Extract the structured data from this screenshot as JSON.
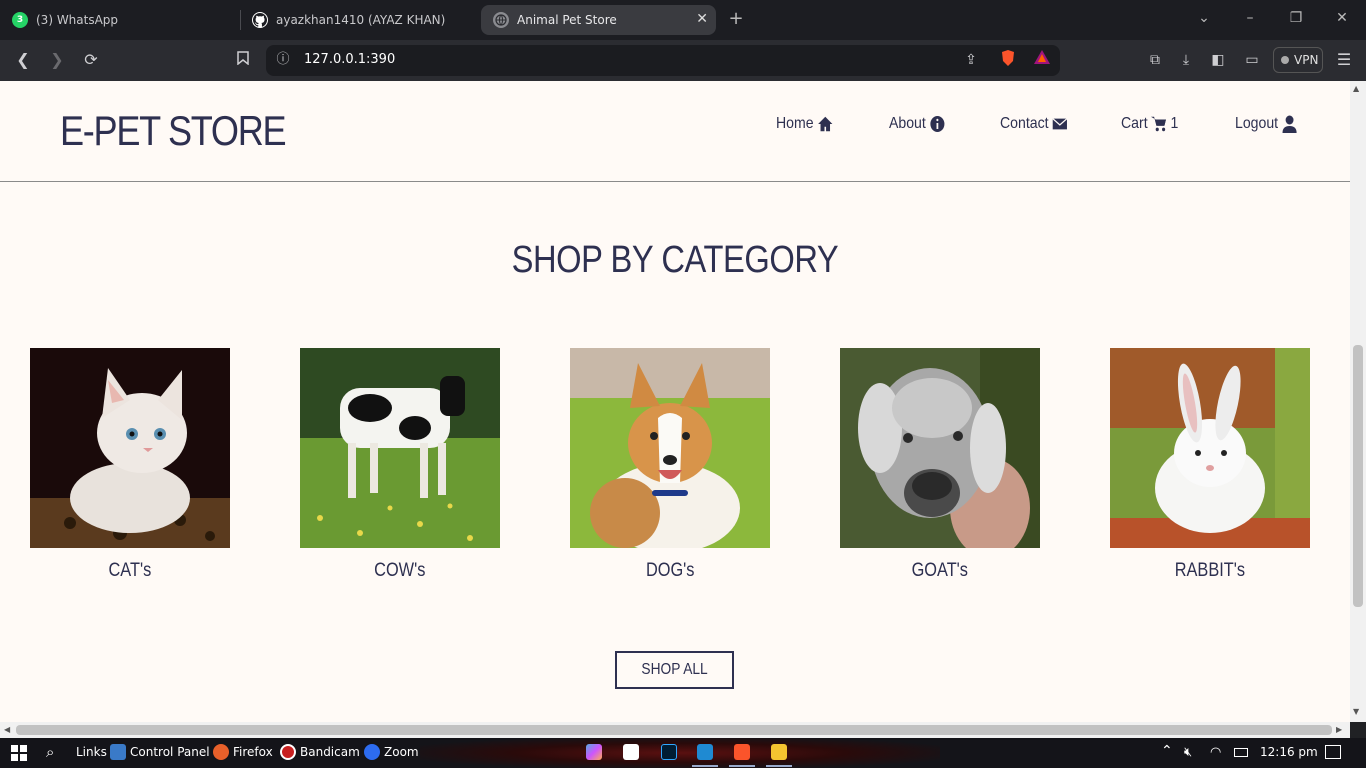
{
  "browser": {
    "tabs": [
      {
        "label": "(3) WhatsApp",
        "icon": "whatsapp-icon",
        "badge": "3"
      },
      {
        "label": "ayazkhan1410 (AYAZ KHAN)",
        "icon": "github-icon"
      },
      {
        "label": "Animal Pet Store",
        "icon": "globe-icon",
        "active": true
      }
    ],
    "new_tab_symbol": "+",
    "url": "127.0.0.1:390",
    "vpn_label": "VPN"
  },
  "site": {
    "brand": "E-PET STORE",
    "nav": [
      {
        "label": "Home",
        "icon": "home-icon"
      },
      {
        "label": "About",
        "icon": "info-icon"
      },
      {
        "label": "Contact",
        "icon": "envelope-icon"
      },
      {
        "label": "Cart",
        "icon": "cart-icon",
        "count": "1"
      },
      {
        "label": "Logout",
        "icon": "user-icon"
      }
    ],
    "heading": "SHOP BY CATEGORY",
    "categories": [
      {
        "label": "CAT's",
        "image": "kitten-photo"
      },
      {
        "label": "COW's",
        "image": "cow-photo"
      },
      {
        "label": "DOG's",
        "image": "corgi-photo"
      },
      {
        "label": "GOAT's",
        "image": "goat-photo"
      },
      {
        "label": "RABBIT's",
        "image": "rabbit-photo"
      }
    ],
    "shop_all": "SHOP ALL"
  },
  "taskbar": {
    "links_label": "Links",
    "items": [
      {
        "label": "Control Panel",
        "icon": "control-panel-icon"
      },
      {
        "label": "Firefox",
        "icon": "firefox-icon"
      },
      {
        "label": "Bandicam",
        "icon": "bandicam-icon"
      },
      {
        "label": "Zoom",
        "icon": "zoom-icon"
      }
    ],
    "time": "12:16 pm"
  },
  "colors": {
    "page_bg": "#fffaf6",
    "text": "#2e3050",
    "browser_dark": "#1c1d22"
  }
}
